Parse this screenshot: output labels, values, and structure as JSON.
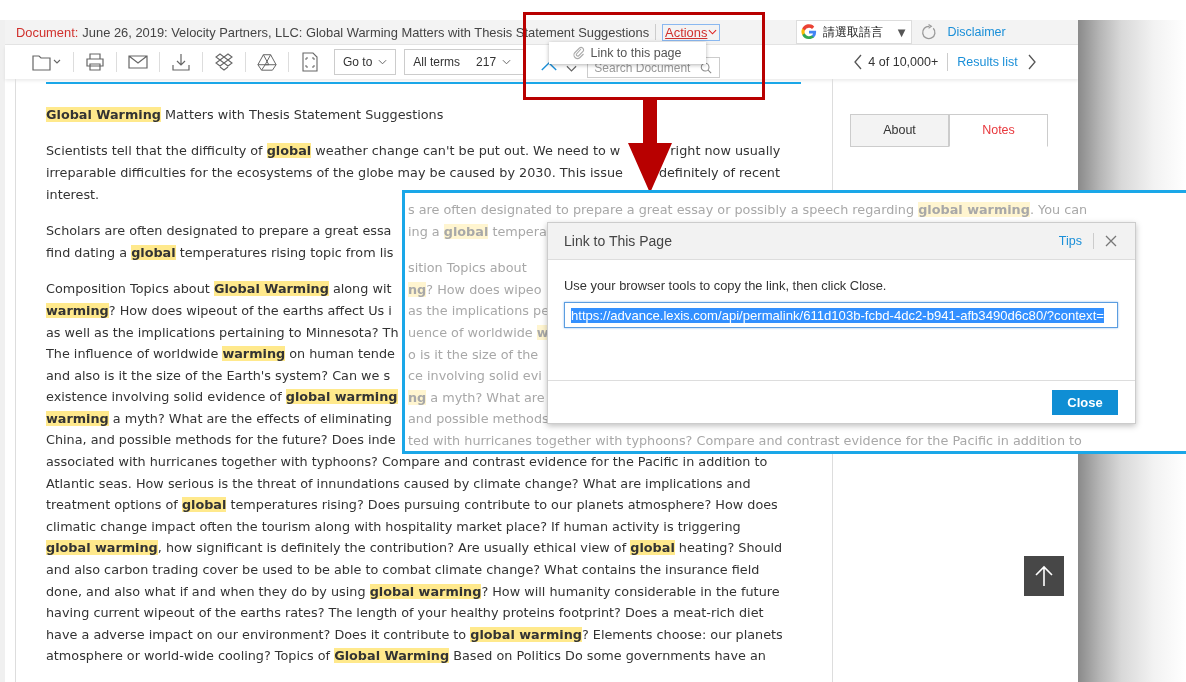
{
  "document_bar": {
    "label": "Document:",
    "title": "June 26, 2019: Velocity Partners, LLC: Global Warming Matters with Thesis Statement Suggestions",
    "actions": "Actions"
  },
  "actions_menu": [
    {
      "label": "Link to this page"
    }
  ],
  "translate": {
    "language": "請選取語言",
    "caret": "▼"
  },
  "disclaimer": "Disclaimer",
  "toolbar": {
    "goto": "Go to",
    "terms": "All terms",
    "term_count": "217",
    "search": {
      "placeholder": "Search Document"
    }
  },
  "pager": {
    "position": "4 of 10,000+",
    "results": "Results list"
  },
  "document": {
    "paragraphs": [
      {
        "lines": [
          {
            "text": "**Global Warming** Matters with Thesis Statement Suggestions"
          }
        ]
      },
      {
        "lines": [
          {
            "text": "Scientists tell that the difficulty of **global** weather change can't be put out. We need to w",
            "after": "right now usually"
          },
          {
            "text": "irreparable difficulties for the ecosystems of the globe may be caused by 2030. This issue",
            "after": "definitely of recent"
          },
          {
            "text": "interest."
          }
        ]
      },
      {
        "lines": [
          {
            "text": "Scholars are often designated to prepare a great essa"
          },
          {
            "text": "find dating a **global** temperatures rising topic from lis"
          }
        ]
      },
      {
        "lines": [
          {
            "text": "Composition Topics about **Global Warming** along wit"
          },
          {
            "text": "**warming**? How does wipeout of the earths affect Us i"
          },
          {
            "text": "as well as the implications pertaining to Minnesota? Th"
          },
          {
            "text": "The influence of worldwide **warming** on human tende"
          },
          {
            "text": "and also is it the size of the Earth's system? Can we s"
          },
          {
            "text": "existence involving solid evidence of **global warming**"
          },
          {
            "text": "**warming** a myth? What are the effects of eliminating"
          },
          {
            "text": "China, and possible methods for the future? Does inde"
          },
          {
            "text": "associated with hurricanes together with typhoons? Compare and contrast evidence for the Pacific in addition to"
          },
          {
            "text": "Atlantic seas. How serious is the threat of innundations caused by climate change? What are implications and"
          },
          {
            "text": "treatment options of **global** temperatures rising? Does pursuing contribute to our planets atmosphere? How does"
          },
          {
            "text": "climatic change impact often the tourism along with hospitality market place? If human activity is triggering"
          },
          {
            "text": "**global warming**, how significant is definitely the contribution? Are usually ethical view of **global** heating? Should"
          },
          {
            "text": "and also carbon trading cover be used to be able to combat climate change? What contains the insurance field"
          },
          {
            "text": "done, and also what if and when they do by using **global warming**? How will humanity considerable in the future"
          },
          {
            "text": "having current wipeout of the earths rates? The length of your healthy proteins footprint? Does a meat-rich diet"
          },
          {
            "text": "have a adverse impact on our environment? Does it contribute to **global warming**? Elements choose: our planets"
          },
          {
            "text": "atmosphere or world-wide cooling? Topics of **Global Warming** Based on Politics Do some governments have an"
          }
        ]
      }
    ]
  },
  "side_tabs": [
    {
      "label": "About",
      "selected": false
    },
    {
      "label": "Notes",
      "selected": true
    }
  ],
  "callout": {
    "paragraphs": [
      {
        "lines": [
          {
            "text": "s are often designated to prepare a great essay or possibly a speech regarding **global warming**. You can"
          },
          {
            "text": "ing a **global** tempera"
          }
        ]
      },
      {
        "lines": [
          {
            "text": "sition Topics about"
          },
          {
            "text": "**ng**? How does wipeo"
          },
          {
            "text": "as the implications pe"
          },
          {
            "text": "uence of worldwide **w**"
          },
          {
            "text": "o is it the size of the"
          },
          {
            "text": "ce involving solid evi"
          },
          {
            "text": "**ng** a myth? What are"
          },
          {
            "text": "and possible methods"
          },
          {
            "text": "ted with hurricanes together with typhoons? Compare and contrast evidence for the Pacific in addition to"
          }
        ]
      }
    ],
    "dialog": {
      "title": "Link to This Page",
      "tips": "Tips",
      "message": "Use your browser tools to copy the link, then click Close.",
      "url": "https://advance.lexis.com/api/permalink/611d103b-fcbd-4dc2-b941-afb3490d6c80/?context=",
      "button": "Close"
    }
  }
}
